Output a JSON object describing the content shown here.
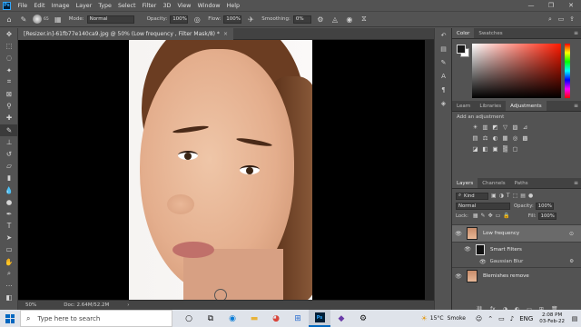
{
  "app": {
    "logo_text": "Ps",
    "menu": [
      "File",
      "Edit",
      "Image",
      "Layer",
      "Type",
      "Select",
      "Filter",
      "3D",
      "View",
      "Window",
      "Help"
    ],
    "window_controls": [
      "—",
      "❐",
      "✕"
    ]
  },
  "options_bar": {
    "mode_label": "Mode:",
    "mode_value": "Normal",
    "opacity_label": "Opacity:",
    "opacity_value": "100%",
    "flow_label": "Flow:",
    "flow_value": "100%",
    "smoothing_label": "Smoothing:",
    "smoothing_value": "0%",
    "brush_size": "65"
  },
  "document": {
    "tab_title": "[Resizer.in]-61fb77e140ca9.jpg @ 50% (Low frequency , Filter Mask/8) *",
    "tab_close": "×"
  },
  "status_bar": {
    "zoom": "50%",
    "doc_info": "Doc: 2.64M/52.2M",
    "arrow": "›"
  },
  "panels": {
    "color_tabs": [
      "Color",
      "Swatches"
    ],
    "adjust_tabs": [
      "Learn",
      "Libraries",
      "Adjustments"
    ],
    "add_adjustment_hint": "Add an adjustment",
    "adj_row1": [
      "☀",
      "▥",
      "◩",
      "▽",
      "▨",
      "⊿"
    ],
    "adj_row2": [
      "▤",
      "⚖",
      "◐",
      "▦",
      "◎",
      "▩"
    ],
    "adj_row3": [
      "◪",
      "◧",
      "▣",
      "▒",
      "▢"
    ],
    "layer_tabs": [
      "Layers",
      "Channels",
      "Paths"
    ],
    "kind_label": "Kind",
    "blend_mode": "Normal",
    "opacity_label": "Opacity:",
    "opacity_value": "100%",
    "lock_label": "Lock:",
    "fill_label": "Fill:",
    "fill_value": "100%",
    "layers": [
      {
        "name": "Low frequency"
      },
      {
        "name": "Smart Filters"
      },
      {
        "name": "Gaussian Blur"
      },
      {
        "name": "Blemishes remove"
      }
    ],
    "footer_icons": [
      "⛓",
      "fx",
      "◑",
      "◐",
      "▭",
      "⊞",
      "🗑"
    ]
  },
  "taskbar": {
    "search_placeholder": "Type here to search",
    "weather_temp": "15°C",
    "weather_text": "Smoke",
    "language": "ENG",
    "time": "2:08 PM",
    "date": "03-Feb-22"
  }
}
